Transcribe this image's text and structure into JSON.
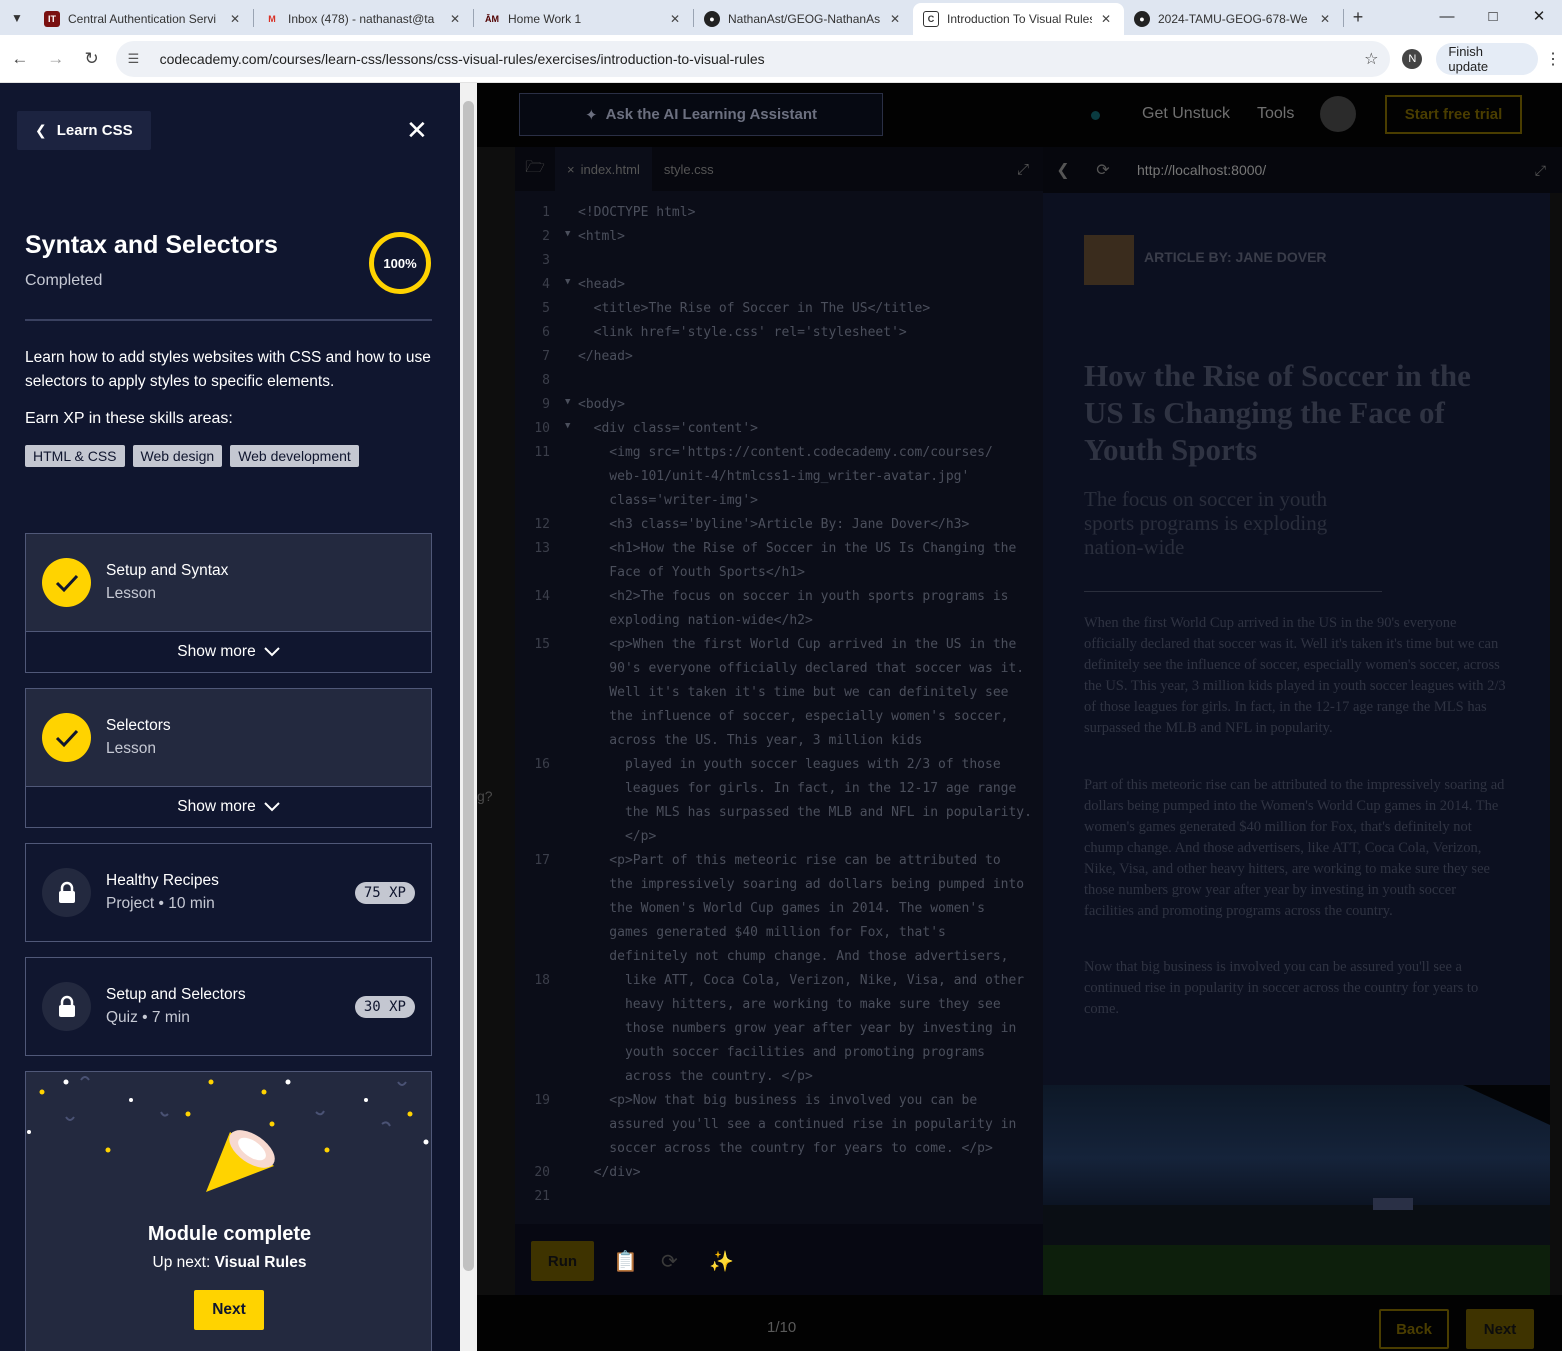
{
  "browser": {
    "tabs": [
      {
        "title": "Central Authentication Servi",
        "icon": "it-icon"
      },
      {
        "title": "Inbox (478) - nathanast@ta",
        "icon": "gmail-icon"
      },
      {
        "title": "Home Work 1",
        "icon": "tamu-icon"
      },
      {
        "title": "NathanAst/GEOG-NathanAs",
        "icon": "github-icon"
      },
      {
        "title": "Introduction To Visual Rules",
        "icon": "codecademy-icon",
        "active": true
      },
      {
        "title": "2024-TAMU-GEOG-678-We",
        "icon": "github-icon"
      }
    ],
    "url": "codecademy.com/courses/learn-css/lessons/css-visual-rules/exercises/introduction-to-visual-rules",
    "profile_initial": "N",
    "finish_update": "Finish update"
  },
  "sidebar": {
    "back_label": "Learn CSS",
    "module_title": "Syntax and Selectors",
    "module_status": "Completed",
    "progress": "100%",
    "description": "Learn how to add styles websites with CSS and how to use selectors to apply styles to specific elements.",
    "earn_label": "Earn XP in these skills areas:",
    "skills": [
      "HTML & CSS",
      "Web design",
      "Web development"
    ],
    "items": [
      {
        "title": "Setup and Syntax",
        "subtitle": "Lesson",
        "state": "completed",
        "more": "Show more"
      },
      {
        "title": "Selectors",
        "subtitle": "Lesson",
        "state": "completed",
        "more": "Show more"
      },
      {
        "title": "Healthy Recipes",
        "subtitle": "Project • 10 min",
        "state": "locked",
        "xp": "75 XP"
      },
      {
        "title": "Setup and Selectors",
        "subtitle": "Quiz • 7 min",
        "state": "locked",
        "xp": "30 XP"
      }
    ],
    "complete": {
      "title": "Module complete",
      "up_next_prefix": "Up next: ",
      "up_next": "Visual Rules",
      "next_label": "Next"
    }
  },
  "workspace": {
    "ai_button": "Ask the AI Learning Assistant",
    "get_unstuck": "Get Unstuck",
    "tools": "Tools",
    "trial": "Start free trial",
    "editor_tabs": [
      "index.html",
      "style.css"
    ],
    "left_fragments": [
      "g?"
    ],
    "code_lines": [
      {
        "n": "1",
        "text": "<!DOCTYPE html>"
      },
      {
        "n": "2",
        "text": "<html>"
      },
      {
        "n": "3",
        "text": ""
      },
      {
        "n": "4",
        "text": "<head>"
      },
      {
        "n": "5",
        "text": "  <title>The Rise of Soccer in The US</title>"
      },
      {
        "n": "6",
        "text": "  <link href='style.css' rel='stylesheet'>"
      },
      {
        "n": "7",
        "text": "</head>"
      },
      {
        "n": "8",
        "text": ""
      },
      {
        "n": "9",
        "text": "<body>"
      },
      {
        "n": "10",
        "text": "  <div class='content'>"
      },
      {
        "n": "11",
        "text": "    <img src='https://content.codecademy.com/courses/"
      },
      {
        "n": "",
        "text": "    web-101/unit-4/htmlcss1-img_writer-avatar.jpg'"
      },
      {
        "n": "",
        "text": "    class='writer-img'>"
      },
      {
        "n": "12",
        "text": "    <h3 class='byline'>Article By: Jane Dover</h3>"
      },
      {
        "n": "13",
        "text": "    <h1>How the Rise of Soccer in the US Is Changing the"
      },
      {
        "n": "",
        "text": "    Face of Youth Sports</h1>"
      },
      {
        "n": "14",
        "text": "    <h2>The focus on soccer in youth sports programs is"
      },
      {
        "n": "",
        "text": "    exploding nation-wide</h2>"
      },
      {
        "n": "15",
        "text": "    <p>When the first World Cup arrived in the US in the"
      },
      {
        "n": "",
        "text": "    90's everyone officially declared that soccer was it."
      },
      {
        "n": "",
        "text": "    Well it's taken it's time but we can definitely see"
      },
      {
        "n": "",
        "text": "    the influence of soccer, especially women's soccer,"
      },
      {
        "n": "",
        "text": "    across the US. This year, 3 million kids"
      },
      {
        "n": "16",
        "text": "      played in youth soccer leagues with 2/3 of those"
      },
      {
        "n": "",
        "text": "      leagues for girls. In fact, in the 12-17 age range"
      },
      {
        "n": "",
        "text": "      the MLS has surpassed the MLB and NFL in popularity."
      },
      {
        "n": "",
        "text": "      </p>"
      },
      {
        "n": "17",
        "text": "    <p>Part of this meteoric rise can be attributed to"
      },
      {
        "n": "",
        "text": "    the impressively soaring ad dollars being pumped into"
      },
      {
        "n": "",
        "text": "    the Women's World Cup games in 2014. The women's"
      },
      {
        "n": "",
        "text": "    games generated $40 million for Fox, that's"
      },
      {
        "n": "",
        "text": "    definitely not chump change. And those advertisers,"
      },
      {
        "n": "18",
        "text": "      like ATT, Coca Cola, Verizon, Nike, Visa, and other"
      },
      {
        "n": "",
        "text": "      heavy hitters, are working to make sure they see"
      },
      {
        "n": "",
        "text": "      those numbers grow year after year by investing in"
      },
      {
        "n": "",
        "text": "      youth soccer facilities and promoting programs"
      },
      {
        "n": "",
        "text": "      across the country. </p>"
      },
      {
        "n": "19",
        "text": "    <p>Now that big business is involved you can be"
      },
      {
        "n": "",
        "text": "    assured you'll see a continued rise in popularity in"
      },
      {
        "n": "",
        "text": "    soccer across the country for years to come. </p>"
      },
      {
        "n": "20",
        "text": "  </div>"
      },
      {
        "n": "21",
        "text": ""
      }
    ],
    "run_label": "Run",
    "preview_url": "http://localhost:8000/",
    "article": {
      "byline": "ARTICLE BY: JANE DOVER",
      "h1": "How the Rise of Soccer in the US Is Changing the Face of Youth Sports",
      "h2": "The focus on soccer in youth sports programs is exploding nation-wide",
      "paragraphs": [
        "When the first World Cup arrived in the US in the 90's everyone officially declared that soccer was it. Well it's taken it's time but we can definitely see the influence of soccer, especially women's soccer, across the US. This year, 3 million kids played in youth soccer leagues with 2/3 of those leagues for girls. In fact, in the 12-17 age range the MLS has surpassed the MLB and NFL in popularity.",
        "Part of this meteoric rise can be attributed to the impressively soaring ad dollars being pumped into the Women's World Cup games in 2014. The women's games generated $40 million for Fox, that's definitely not chump change. And those advertisers, like ATT, Coca Cola, Verizon, Nike, Visa, and other heavy hitters, are working to make sure they see those numbers grow year after year by investing in youth soccer facilities and promoting programs across the country.",
        "Now that big business is involved you can be assured you'll see a continued rise in popularity in soccer across the country for years to come."
      ]
    },
    "pager": "1/10",
    "back_label": "Back",
    "next_label": "Next"
  },
  "colors": {
    "sidebar_bg": "#10162f",
    "accent_yellow": "#ffd300",
    "card_bg": "#23293f"
  }
}
